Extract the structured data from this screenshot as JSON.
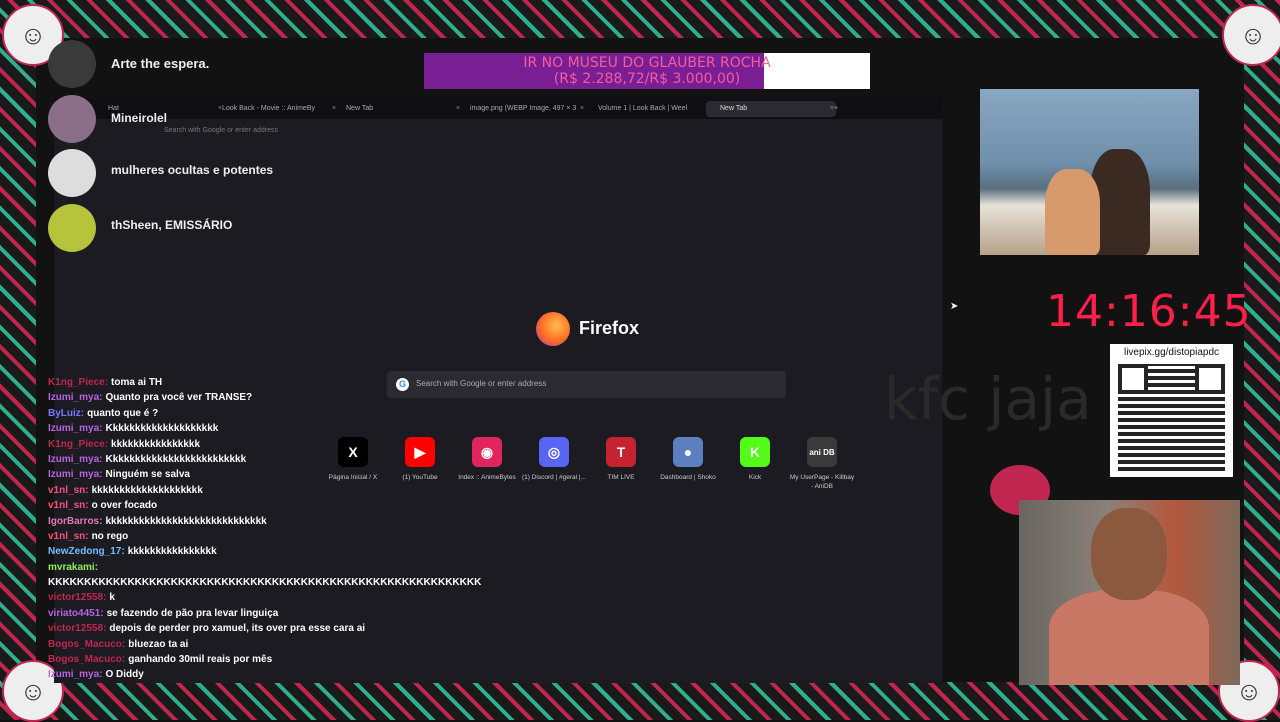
{
  "browser": {
    "tabs": [
      {
        "label": "Hat",
        "active": false
      },
      {
        "label": "Look Back - Movie :: AnimeBy",
        "active": false
      },
      {
        "label": "New Tab",
        "active": false
      },
      {
        "label": "image.png (WEBP Image, 497 × 3",
        "active": false
      },
      {
        "label": "Volume 1 | Look Back | Weel",
        "active": false
      },
      {
        "label": "New Tab",
        "active": true
      }
    ],
    "new_tab_symbol": "+",
    "close_symbol": "×",
    "url_placeholder": "Search with Google or enter address",
    "brand": "Firefox",
    "search_placeholder": "Search with Google or enter address",
    "shortcuts": [
      {
        "icon": "x-icon",
        "glyph": "X",
        "color": "#000000",
        "label": "Página Inicial / X"
      },
      {
        "icon": "youtube-icon",
        "glyph": "▶",
        "color": "#ff0000",
        "label": "(1) YouTube"
      },
      {
        "icon": "animebytes-icon",
        "glyph": "◉",
        "color": "#e0245e",
        "label": "Index :: AnimeBytes"
      },
      {
        "icon": "discord-icon",
        "glyph": "◎",
        "color": "#5865f2",
        "label": "(1) Discord | #geral |..."
      },
      {
        "icon": "tim-icon",
        "glyph": "T",
        "color": "#c4232f",
        "label": "TIM LIVE"
      },
      {
        "icon": "shoko-icon",
        "glyph": "●",
        "color": "#5b7fbf",
        "label": "Dashboard | Shoko"
      },
      {
        "icon": "kick-icon",
        "glyph": "K",
        "color": "#53fc18",
        "label": "Kick"
      },
      {
        "icon": "anidb-icon",
        "glyph": "ani DB",
        "color": "#3a3a3a",
        "label": "My UserPage - Killbay - AniDB"
      }
    ]
  },
  "goal": {
    "title": "IR NO MUSEU DO GLAUBER ROCHA",
    "amount": "(R$ 2.288,72/R$ 3.000,00)",
    "progress": 0.763
  },
  "events": [
    {
      "name": "Arte",
      "text": "Arte the espera."
    },
    {
      "name": "Mineirolel",
      "text": "Mineirolel"
    },
    {
      "name": "mulheres",
      "text": "mulheres ocultas e potentes"
    },
    {
      "name": "thSheen",
      "text": "thSheen, EMISSÁRIO"
    }
  ],
  "chat": [
    {
      "user": "K1ng_Piece:",
      "color": "#c0264f",
      "text": "toma ai TH"
    },
    {
      "user": "Izumi_mya:",
      "color": "#b565e0",
      "text": "Quanto pra você ver TRANSE?"
    },
    {
      "user": "ByLuiz:",
      "color": "#7a78ff",
      "text": "quanto que é ?"
    },
    {
      "user": "Izumi_mya:",
      "color": "#b565e0",
      "text": "Kkkkkkkkkkkkkkkkkkkk"
    },
    {
      "user": "K1ng_Piece:",
      "color": "#c0264f",
      "text": "kkkkkkkkkkkkkkkk"
    },
    {
      "user": "Izumi_mya:",
      "color": "#b565e0",
      "text": "Kkkkkkkkkkkkkkkkkkkkkkkkk"
    },
    {
      "user": "Izumi_mya:",
      "color": "#b565e0",
      "text": "Ninguém se salva"
    },
    {
      "user": "v1nl_sn:",
      "color": "#ff4f7a",
      "text": "kkkkkkkkkkkkkkkkkkkk"
    },
    {
      "user": "v1nl_sn:",
      "color": "#ff4f7a",
      "text": "o over focado"
    },
    {
      "user": "IgorBarros:",
      "color": "#e07ab5",
      "text": "kkkkkkkkkkkkkkkkkkkkkkkkkkkkk"
    },
    {
      "user": "v1nl_sn:",
      "color": "#ff4f7a",
      "text": "no rego"
    },
    {
      "user": "NewZedong_17:",
      "color": "#6fc0ff",
      "text": "kkkkkkkkkkkkkkkk"
    },
    {
      "user": "mvrakami:",
      "color": "#8df25a",
      "text": ""
    },
    {
      "user": "",
      "color": "#ffffff",
      "text": "KKKKKKKKKKKKKKKKKKKKKKKKKKKKKKKKKKKKKKKKKKKKKKKKKKKKKKKKKKKK"
    },
    {
      "user": "victor12558:",
      "color": "#c0264f",
      "text": "k"
    },
    {
      "user": "viriato4451:",
      "color": "#b565e0",
      "text": "se fazendo de pão pra levar linguiça"
    },
    {
      "user": "victor12558:",
      "color": "#c0264f",
      "text": "depois de perder pro xamuel, its over pra esse cara ai"
    },
    {
      "user": "Bogos_Macuco:",
      "color": "#c0264f",
      "text": "bluezao ta ai"
    },
    {
      "user": "Bogos_Macuco:",
      "color": "#c0264f",
      "text": "ganhando 30mil reais por mês"
    },
    {
      "user": "Izumi_mya:",
      "color": "#b565e0",
      "text": "O Diddy"
    }
  ],
  "clock": "14:16:45",
  "overlay_text": "kfc jaja",
  "qr_label": "livepix.gg/distopiapdc"
}
